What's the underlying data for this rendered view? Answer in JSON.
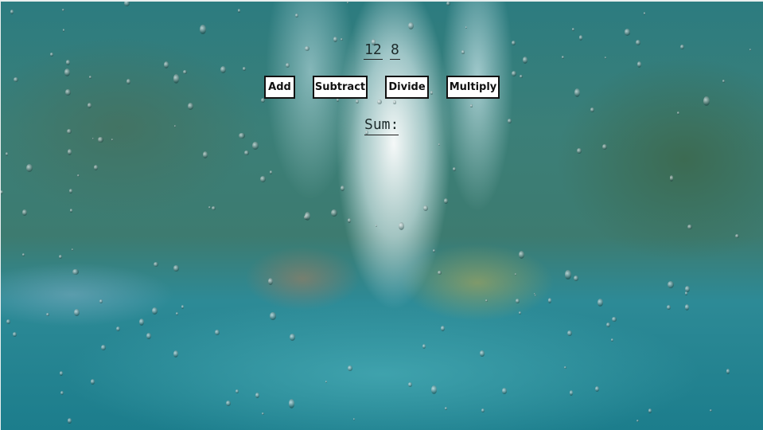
{
  "operands": {
    "a": "12",
    "b": "8"
  },
  "buttons": {
    "add": "Add",
    "subtract": "Subtract",
    "divide": "Divide",
    "multiply": "Multiply"
  },
  "result": {
    "label": "Sum:"
  },
  "colors": {
    "button_bg": "#ffffff",
    "button_border": "#111111",
    "text": "#1d2b2b",
    "background_teal": "#1c7d8c"
  },
  "background": {
    "description_icon": "rainy-city-window-image"
  }
}
